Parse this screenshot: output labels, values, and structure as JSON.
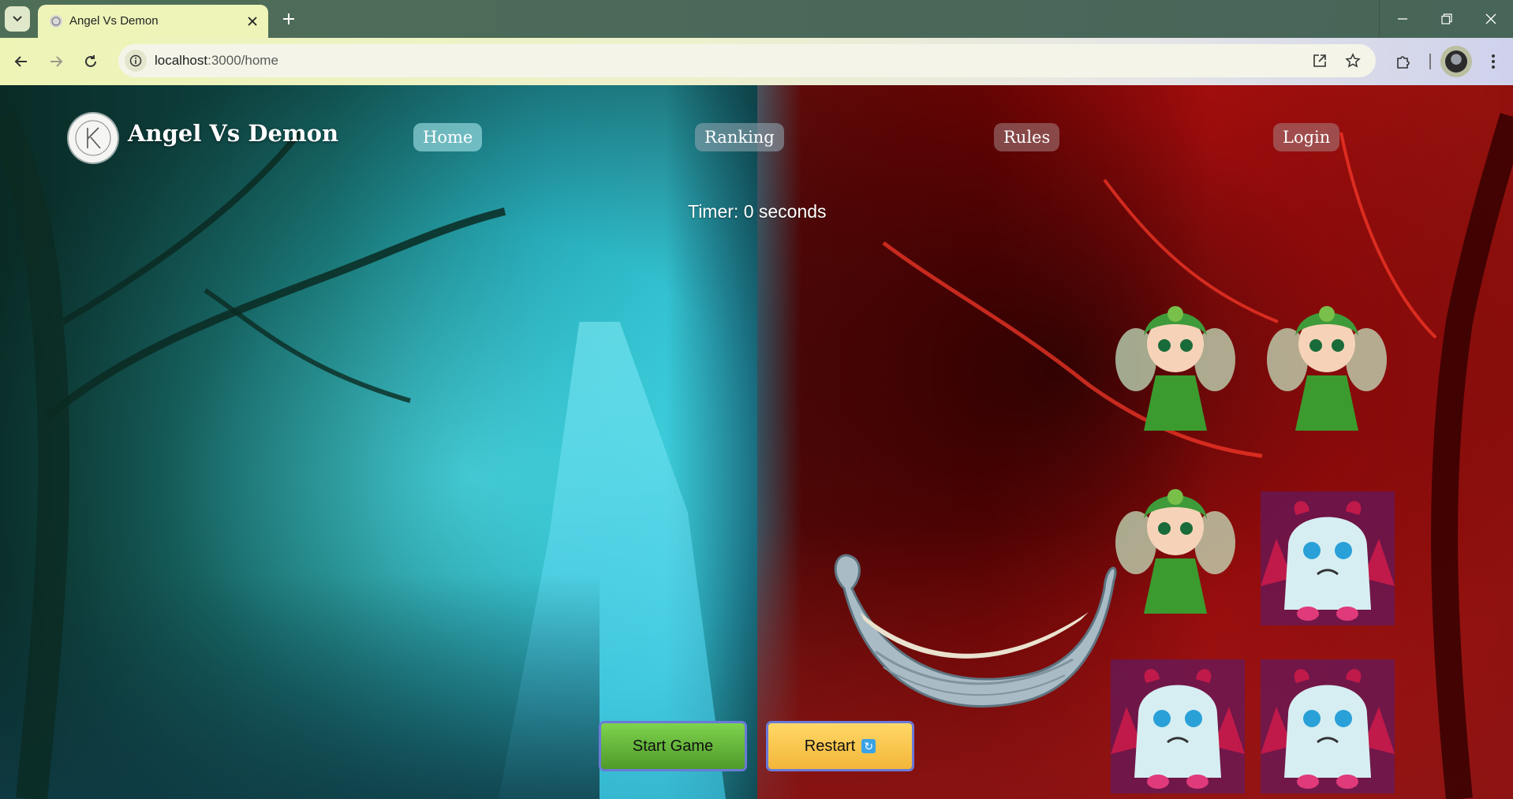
{
  "browser": {
    "tab_title": "Angel Vs Demon",
    "url_host": "localhost",
    "url_path": ":3000/home"
  },
  "header": {
    "title": "Angel Vs Demon",
    "nav": {
      "home": "Home",
      "ranking": "Ranking",
      "rules": "Rules",
      "login": "Login"
    }
  },
  "game": {
    "timer_text": "Timer: 0 seconds",
    "characters": [
      {
        "type": "angel",
        "name": "angel-sprite"
      },
      {
        "type": "angel",
        "name": "angel-sprite"
      },
      {
        "type": "angel",
        "name": "angel-sprite"
      },
      {
        "type": "demon",
        "name": "demon-sprite"
      },
      {
        "type": "demon",
        "name": "demon-sprite"
      },
      {
        "type": "demon",
        "name": "demon-sprite"
      }
    ],
    "boat": "boat-sprite"
  },
  "controls": {
    "start_label": "Start Game",
    "restart_label": "Restart"
  },
  "colors": {
    "start_button": "#5fb534",
    "restart_button": "#f7c54a",
    "button_border": "#6a7ad8"
  }
}
